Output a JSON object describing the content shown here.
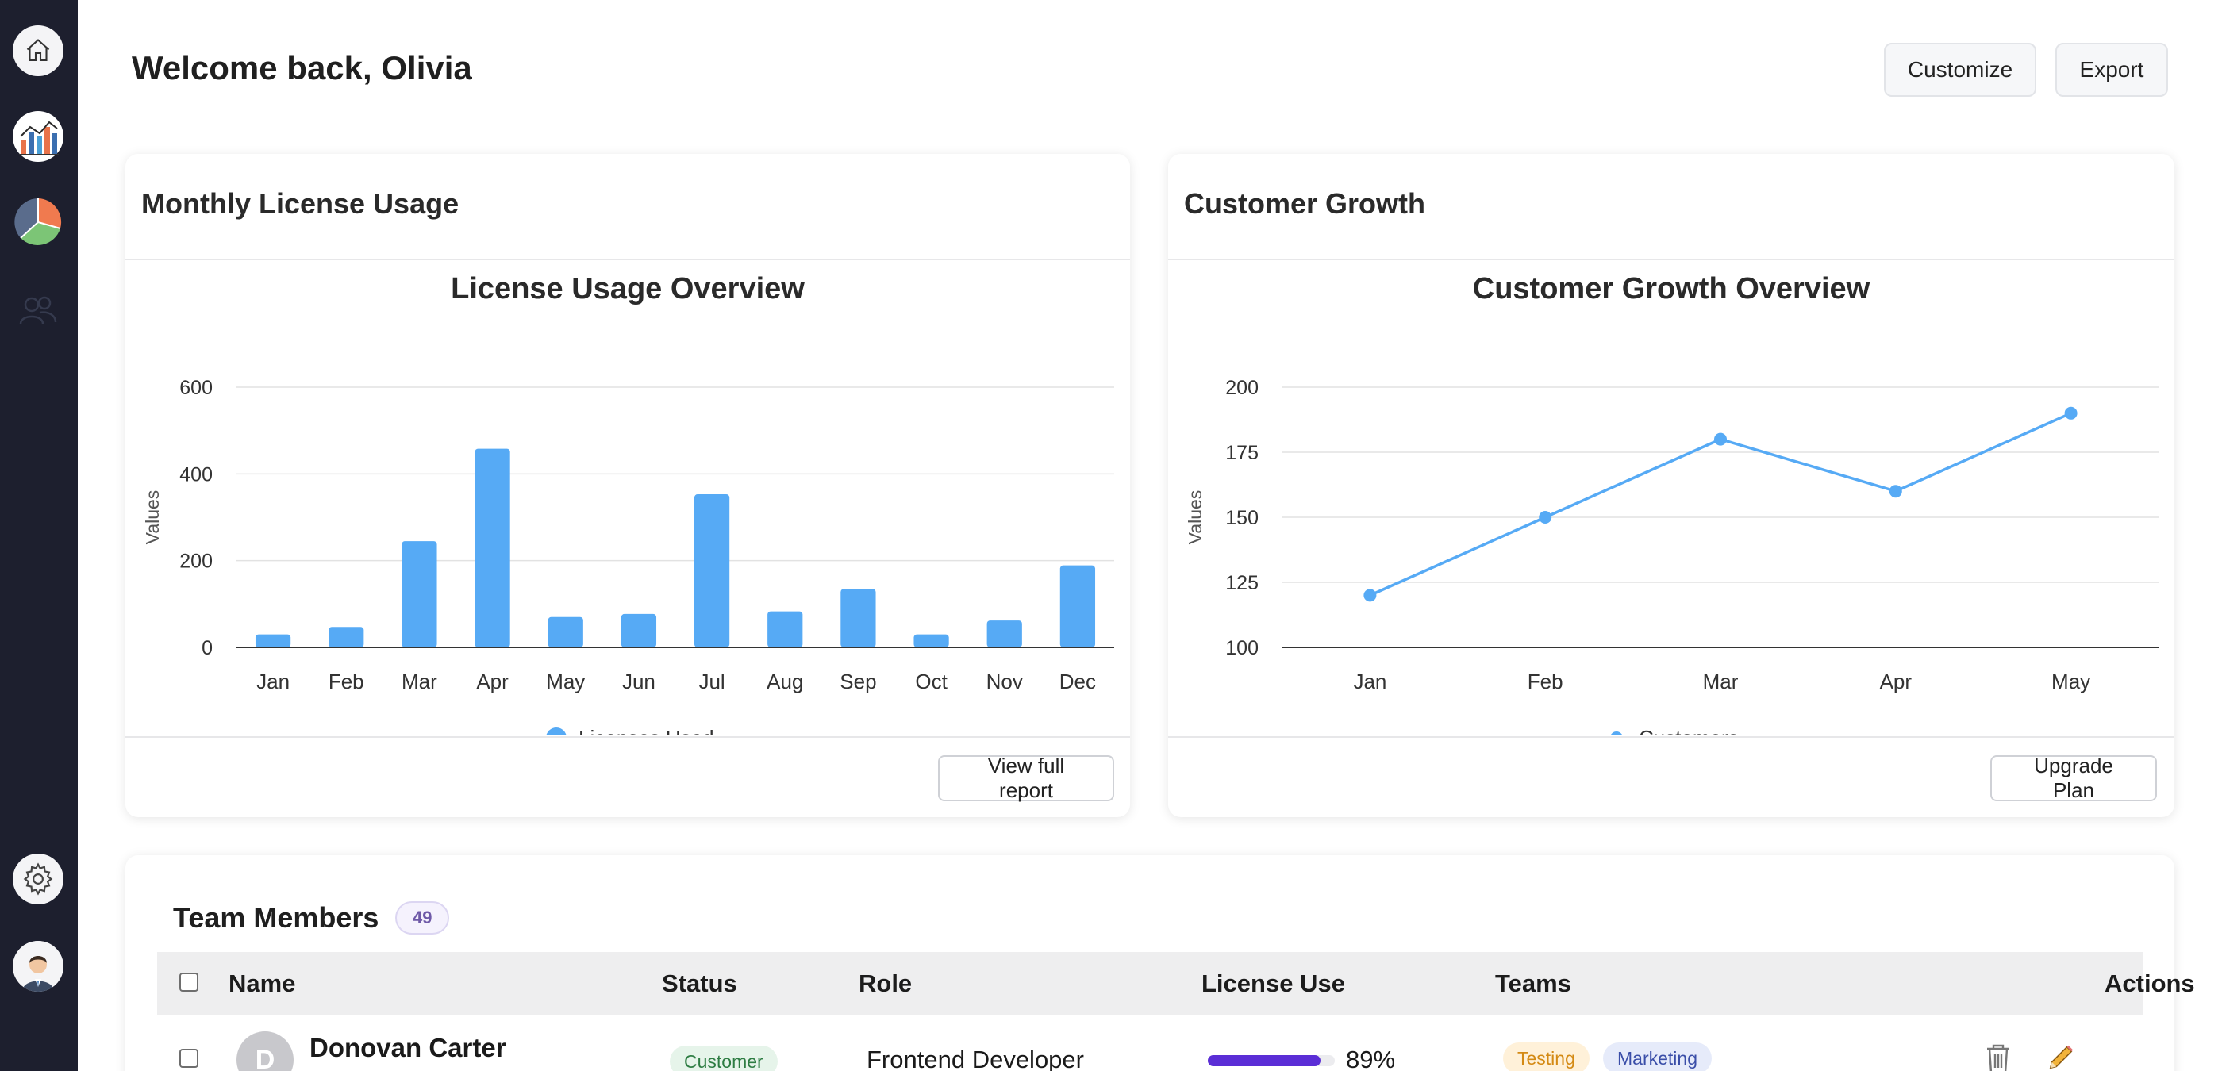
{
  "header": {
    "title": "Welcome back, Olivia",
    "customize_label": "Customize",
    "export_label": "Export"
  },
  "sidebar": {
    "items": [
      {
        "icon": "home-icon"
      },
      {
        "icon": "bar-chart-icon"
      },
      {
        "icon": "pie-chart-icon"
      },
      {
        "icon": "users-icon"
      },
      {
        "icon": "gear-icon"
      },
      {
        "icon": "avatar-icon"
      }
    ]
  },
  "license_card": {
    "title": "Monthly License Usage",
    "footer_button": "View full report"
  },
  "growth_card": {
    "title": "Customer Growth",
    "footer_button": "Upgrade Plan"
  },
  "chart_data": [
    {
      "type": "bar",
      "title": "License Usage Overview",
      "ylabel": "Values",
      "xlabel": "",
      "categories": [
        "Jan",
        "Feb",
        "Mar",
        "Apr",
        "May",
        "Jun",
        "Jul",
        "Aug",
        "Sep",
        "Oct",
        "Nov",
        "Dec"
      ],
      "series": [
        {
          "name": "Licenses Used",
          "values": [
            30,
            47,
            245,
            458,
            70,
            77,
            353,
            83,
            135,
            30,
            62,
            189
          ]
        }
      ],
      "yticks": [
        0,
        200,
        400,
        600
      ],
      "ylim": [
        0,
        600
      ],
      "grid": true,
      "legend": "bottom",
      "color": "#56aaf5"
    },
    {
      "type": "line",
      "title": "Customer Growth Overview",
      "ylabel": "Values",
      "xlabel": "",
      "categories": [
        "Jan",
        "Feb",
        "Mar",
        "Apr",
        "May"
      ],
      "series": [
        {
          "name": "Customers",
          "values": [
            120,
            150,
            180,
            160,
            190
          ]
        }
      ],
      "yticks": [
        100,
        125,
        150,
        175,
        200
      ],
      "ylim": [
        100,
        200
      ],
      "grid": true,
      "legend": "bottom",
      "color": "#56aaf5"
    }
  ],
  "team": {
    "title": "Team Members",
    "count": "49",
    "columns": [
      "Name",
      "Status",
      "Role",
      "License Use",
      "Teams",
      "Actions"
    ],
    "rows": [
      {
        "initial": "D",
        "name": "Donovan Carter",
        "status": "Customer",
        "role": "Frontend Developer",
        "license_use": 0.89,
        "license_use_label": "89%",
        "teams": [
          "Testing",
          "Marketing"
        ]
      }
    ]
  }
}
